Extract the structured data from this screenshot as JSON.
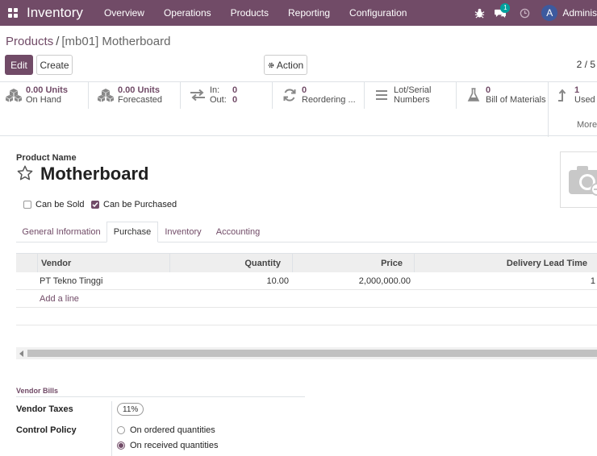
{
  "navbar": {
    "brand": "Inventory",
    "menu": [
      "Overview",
      "Operations",
      "Products",
      "Reporting",
      "Configuration"
    ],
    "chat_badge": "1",
    "user_initial": "A",
    "user_name": "Adminis",
    "bg_color": "#714b67"
  },
  "breadcrumb": {
    "parent": "Products",
    "separator": "/",
    "current": "[mb01] Motherboard"
  },
  "toolbar": {
    "edit_label": "Edit",
    "create_label": "Create",
    "action_label": "Action",
    "pager": "2 / 5"
  },
  "stats": {
    "on_hand": {
      "value": "0.00 Units",
      "label": "On Hand",
      "icon": "cubes-icon"
    },
    "forecasted": {
      "value": "0.00 Units",
      "label": "Forecasted",
      "icon": "cubes-icon"
    },
    "in_out": {
      "in_label": "In:",
      "in_value": "0",
      "out_label": "Out:",
      "out_value": "0",
      "icon": "exchange-icon"
    },
    "reordering": {
      "value": "0",
      "label": "Reordering ...",
      "icon": "refresh-icon"
    },
    "lot_serial": {
      "line1": "Lot/Serial",
      "line2": "Numbers",
      "icon": "list-icon"
    },
    "bom": {
      "value": "0",
      "label": "Bill of Materials",
      "icon": "flask-icon"
    },
    "used": {
      "value": "1",
      "label": "Used",
      "icon": "level-up-icon"
    },
    "more_label": "More"
  },
  "product": {
    "name_label": "Product Name",
    "name": "Motherboard",
    "can_be_sold_label": "Can be Sold",
    "can_be_sold": false,
    "can_be_purchased_label": "Can be Purchased",
    "can_be_purchased": true
  },
  "tabs": [
    {
      "label": "General Information",
      "active": false
    },
    {
      "label": "Purchase",
      "active": true
    },
    {
      "label": "Inventory",
      "active": false
    },
    {
      "label": "Accounting",
      "active": false
    }
  ],
  "vendor_table": {
    "columns": [
      "Vendor",
      "Quantity",
      "Price",
      "Delivery Lead Time"
    ],
    "rows": [
      {
        "vendor": "PT Tekno Tinggi",
        "quantity": "10.00",
        "price": "2,000,000.00",
        "lead_time": "1"
      }
    ],
    "add_line_label": "Add a line"
  },
  "vendor_bills": {
    "title": "Vendor Bills",
    "taxes_label": "Vendor Taxes",
    "tax_tag": "11%",
    "control_policy_label": "Control Policy",
    "options": [
      "On ordered quantities",
      "On received quantities"
    ],
    "selected_index": 1
  }
}
